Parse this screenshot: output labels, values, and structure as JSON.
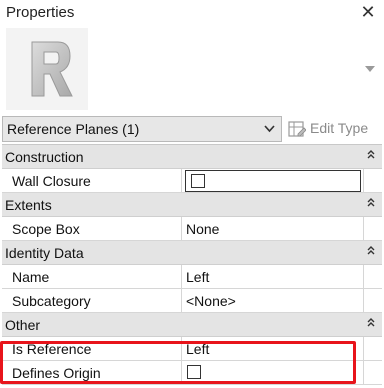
{
  "panel": {
    "title": "Properties"
  },
  "type_selector": {
    "selected": "Reference Planes (1)",
    "edit_type_label": "Edit Type"
  },
  "groups": [
    {
      "label": "Construction",
      "rows": [
        {
          "name": "Wall Closure",
          "value": "",
          "checkbox": true,
          "checked": false
        }
      ]
    },
    {
      "label": "Extents",
      "rows": [
        {
          "name": "Scope Box",
          "value": "None"
        }
      ]
    },
    {
      "label": "Identity Data",
      "rows": [
        {
          "name": "Name",
          "value": "Left"
        },
        {
          "name": "Subcategory",
          "value": "<None>"
        }
      ]
    },
    {
      "label": "Other",
      "rows": [
        {
          "name": "Is Reference",
          "value": "Left"
        },
        {
          "name": "Defines Origin",
          "value": "",
          "checkbox": true,
          "checked": false
        }
      ]
    }
  ],
  "colors": {
    "highlight": "#e8141b",
    "group_header": "#e4e4e4"
  }
}
